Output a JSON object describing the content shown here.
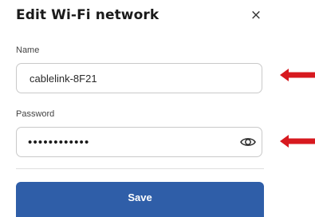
{
  "dialog": {
    "title": "Edit Wi-Fi network",
    "close_icon": "close-icon",
    "close_label": "×"
  },
  "fields": {
    "name": {
      "label": "Name",
      "value": "cablelink-8F21"
    },
    "password": {
      "label": "Password",
      "masked_value": "••••••••••••",
      "toggle_icon": "eye-icon"
    }
  },
  "actions": {
    "save_label": "Save"
  },
  "colors": {
    "primary": "#2f5ea8",
    "annotation_arrow": "#d7191f",
    "border": "#c9c9c9"
  }
}
